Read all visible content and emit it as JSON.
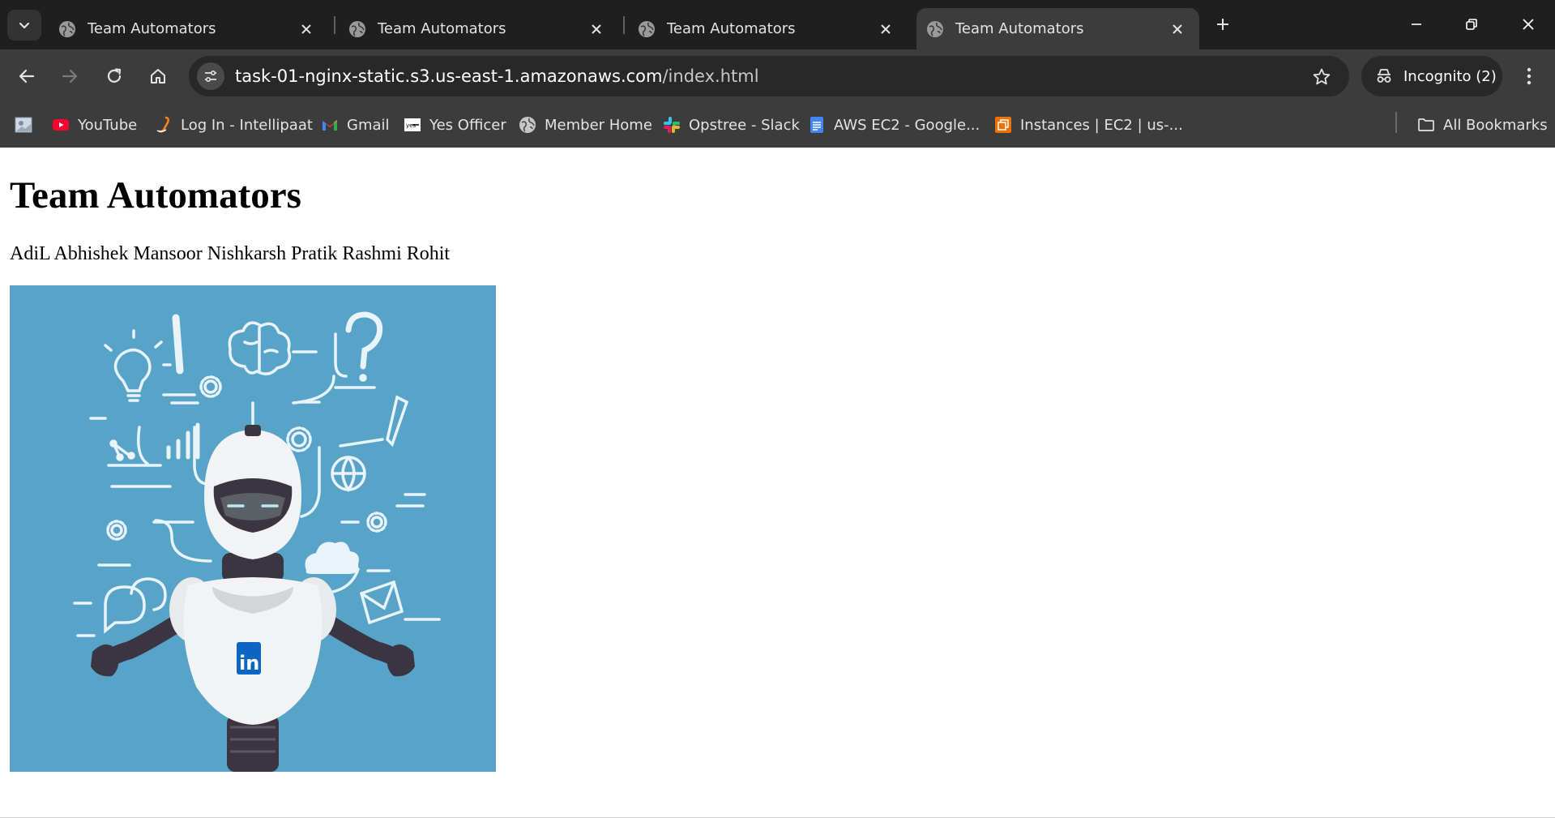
{
  "tabs": [
    {
      "title": "Team Automators",
      "active": false
    },
    {
      "title": "Team Automators",
      "active": false
    },
    {
      "title": "Team Automators",
      "active": false
    },
    {
      "title": "Team Automators",
      "active": true
    }
  ],
  "toolbar": {
    "url_host": "task-01-nginx-static.s3.us-east-1.amazonaws.com",
    "url_path": "/index.html",
    "incognito_label": "Incognito (2)"
  },
  "bookmarks": [
    {
      "label": "",
      "icon": "image-thumbnail-icon"
    },
    {
      "label": "YouTube",
      "icon": "youtube-icon"
    },
    {
      "label": "Log In - Intellipaat",
      "icon": "intellipaat-icon"
    },
    {
      "label": "Gmail",
      "icon": "gmail-icon"
    },
    {
      "label": "Yes Officer",
      "icon": "yes-officer-icon"
    },
    {
      "label": "Member Home",
      "icon": "globe-icon"
    },
    {
      "label": "Opstree - Slack",
      "icon": "slack-icon"
    },
    {
      "label": "AWS EC2 - Google...",
      "icon": "google-docs-icon"
    },
    {
      "label": "Instances | EC2 | us-...",
      "icon": "aws-ec2-icon"
    }
  ],
  "all_bookmarks_label": "All Bookmarks",
  "page": {
    "heading": "Team Automators",
    "members": "AdiL Abhishek Mansoor Nishkarsh Pratik Rashmi Rohit",
    "image_badge": "in"
  },
  "colors": {
    "tabstrip_bg": "#1f1f1f",
    "toolbar_bg": "#3c3c3c",
    "omnibox_bg": "#282828",
    "image_bg": "#57a4c8",
    "linkedin_blue": "#0a66c2"
  }
}
